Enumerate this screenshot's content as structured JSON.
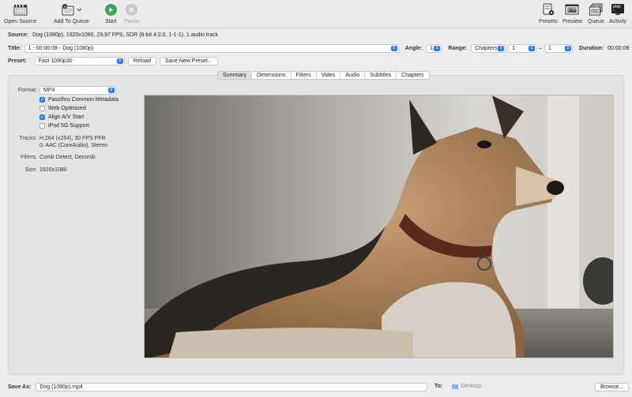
{
  "toolbar": {
    "open_source": "Open Source",
    "add_to_queue": "Add To Queue",
    "start": "Start",
    "pause": "Pause",
    "presets": "Presets",
    "preview": "Preview",
    "queue": "Queue",
    "activity": "Activity"
  },
  "source": {
    "label": "Source:",
    "value": "Dog (1080p), 1920x1080, 29,97 FPS, SDR (8-bit 4:2:0, 1-1-1), 1 audio track"
  },
  "title_row": {
    "label": "Title:",
    "value": "1 - 00:00:08 - Dog (1080p)",
    "angle_label": "Angle:",
    "angle_value": "1",
    "range_label": "Range:",
    "range_type": "Chapters",
    "range_start": "1",
    "range_sep": "–",
    "range_end": "1",
    "duration_label": "Duration:",
    "duration_value": "00:00:08"
  },
  "preset_row": {
    "label": "Preset:",
    "value": "Fast 1080p30",
    "reload": "Reload",
    "save_new": "Save New Preset..."
  },
  "tabs": [
    "Summary",
    "Dimensions",
    "Filters",
    "Video",
    "Audio",
    "Subtitles",
    "Chapters"
  ],
  "summary": {
    "format_label": "Format:",
    "format_value": "MP4",
    "checkboxes": [
      {
        "label": "Passthru Common Metadata",
        "checked": true
      },
      {
        "label": "Web Optimized",
        "checked": false
      },
      {
        "label": "Align A/V Start",
        "checked": true
      },
      {
        "label": "iPod 5G Support",
        "checked": false
      }
    ],
    "tracks_label": "Tracks:",
    "tracks_line1": "H.264 (x264), 30 FPS PFR",
    "tracks_line2": "0: AAC (CoreAudio), Stereo",
    "filters_label": "Filters:",
    "filters_value": "Comb Detect, Decomb",
    "size_label": "Size:",
    "size_value": "1920x1080"
  },
  "save": {
    "label": "Save As:",
    "value": "Dog (1080p).mp4",
    "to_label": "To:",
    "to_value": "Desktop",
    "browse": "Browse..."
  },
  "colors": {
    "accent": "#2f7ef3",
    "start_green": "#3aa657",
    "pause_gray": "#bfbfbf"
  }
}
